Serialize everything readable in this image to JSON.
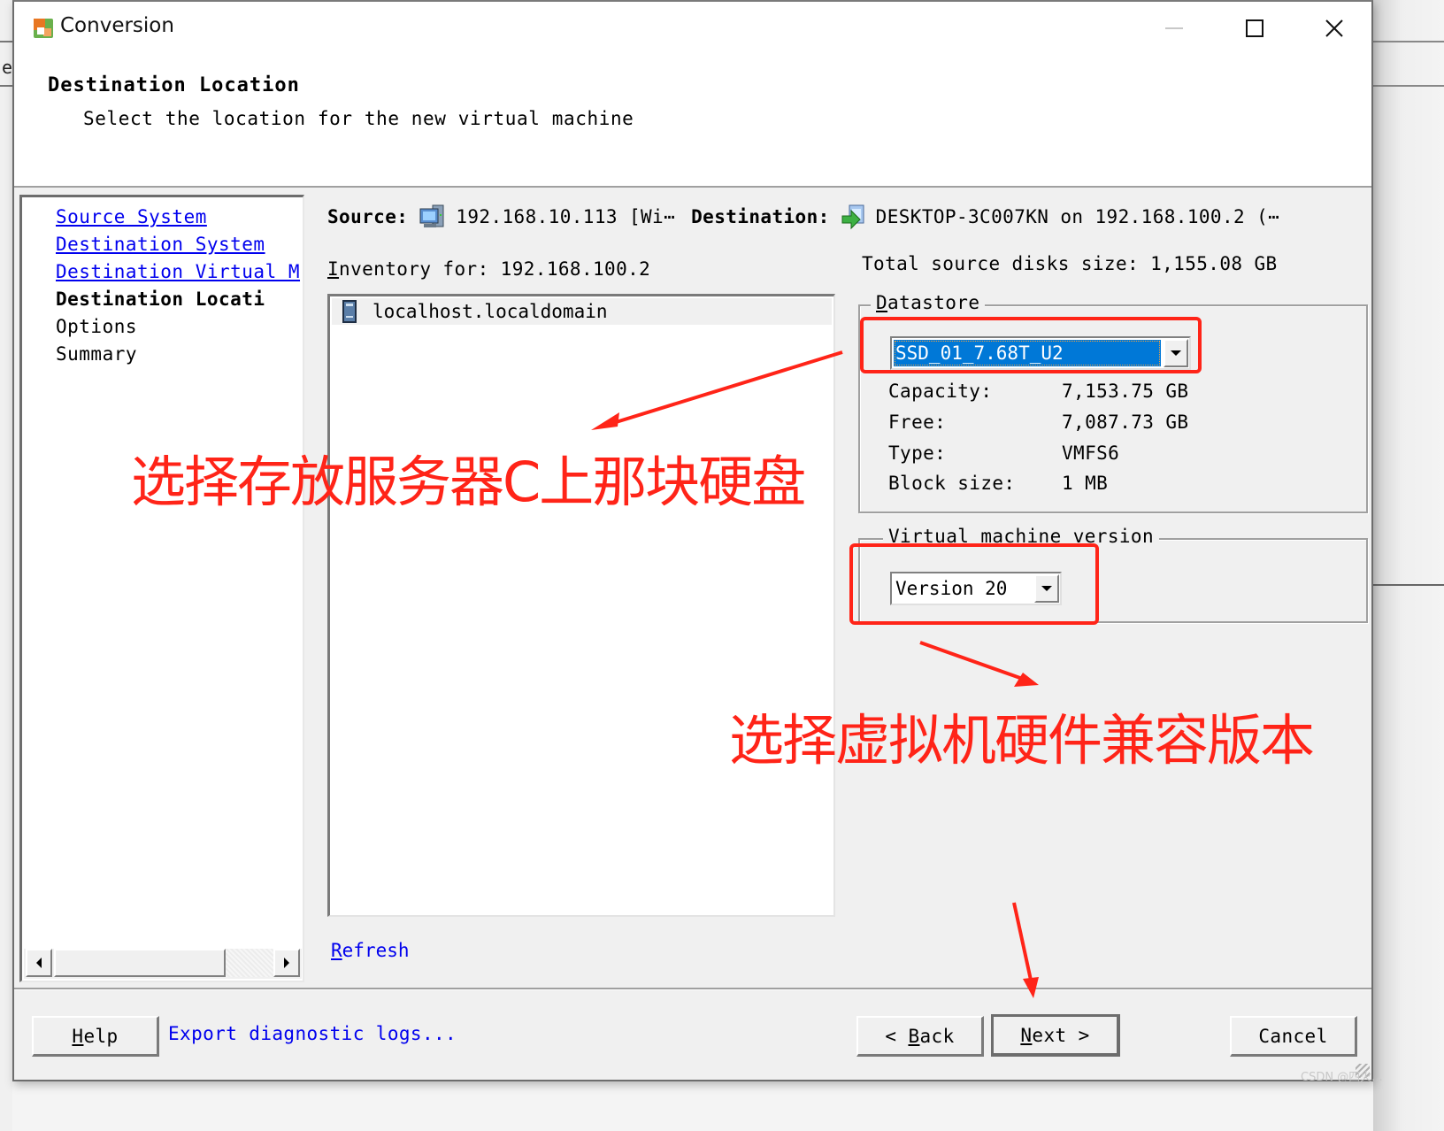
{
  "window": {
    "title": "Conversion",
    "controls": {
      "minimize": "minimize",
      "maximize": "maximize",
      "close": "close"
    }
  },
  "background": {
    "peek_letter": "e"
  },
  "header": {
    "title": "Destination Location",
    "subtitle": "Select the location for the new virtual machine"
  },
  "steps": [
    {
      "label": "Source System",
      "state": "link"
    },
    {
      "label": "Destination System",
      "state": "link"
    },
    {
      "label": "Destination Virtual M",
      "state": "link"
    },
    {
      "label": "Destination Locati",
      "state": "current"
    },
    {
      "label": "Options",
      "state": "pending"
    },
    {
      "label": "Summary",
      "state": "pending"
    }
  ],
  "summary_bar": {
    "source_label": "Source:",
    "source_value": "192.168.10.113 [Wi⋯",
    "destination_label": "Destination:",
    "destination_value": "DESKTOP-3C007KN on 192.168.100.2 (⋯"
  },
  "inventory": {
    "label_mnemonic": "I",
    "label_rest": "nventory for: 192.168.100.2",
    "items": [
      {
        "label": "localhost.localdomain",
        "icon": "host-icon"
      }
    ],
    "refresh_mnemonic": "R",
    "refresh_rest": "efresh"
  },
  "datastore": {
    "total_source_label": "Total source disks size:",
    "total_source_value": "1,155.08 GB",
    "group_mnemonic": "D",
    "group_rest": "atastore",
    "selected": "SSD_01_7.68T_U2",
    "details": [
      {
        "label": "Capacity:",
        "value": "7,153.75 GB"
      },
      {
        "label": "Free:",
        "value": "7,087.73 GB"
      },
      {
        "label": "Type:",
        "value": "VMFS6"
      },
      {
        "label": "Block size:",
        "value": "1 MB"
      }
    ]
  },
  "vm_version": {
    "group_label": "Virtual machine version",
    "selected": "Version 20"
  },
  "footer": {
    "help_mnemonic": "H",
    "help_rest": "elp",
    "export_link": "Export diagnostic logs...",
    "back_prefix": "< ",
    "back_mnemonic": "B",
    "back_rest": "ack",
    "next_mnemonic": "N",
    "next_rest": "ext >",
    "cancel": "Cancel"
  },
  "annotations": {
    "note_datastore": "选择存放服务器C上那块硬盘",
    "note_version": "选择虚拟机硬件兼容版本",
    "color": "#ff2418"
  },
  "watermark": "CSDN @四火..."
}
